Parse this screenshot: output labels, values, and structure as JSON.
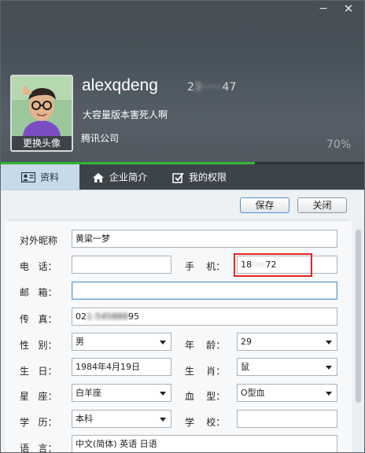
{
  "window": {
    "min_glyph": "−",
    "close_glyph": "✕"
  },
  "profile": {
    "avatar_caption": "更换头像",
    "nickname": "alexqdeng",
    "qq_prefix": "2",
    "qq_hidden": "3······",
    "qq_suffix": "47",
    "signature": "大容量版本害死人啊",
    "company": "腾讯公司",
    "completion_text": "70%",
    "completion": 0.7
  },
  "tabs": [
    {
      "label": "资料",
      "icon": "profile-card-icon",
      "active": true
    },
    {
      "label": "企业简介",
      "icon": "home-icon",
      "active": false
    },
    {
      "label": "我的权限",
      "icon": "checkbox-icon",
      "active": false
    }
  ],
  "toolbar": {
    "save_label": "保存",
    "close_label": "关闭"
  },
  "form": {
    "nickname_label": "对外昵称",
    "nickname_value": "黄粱一梦",
    "phone_label": "电   话：",
    "phone_value": "",
    "mobile_label": "手    机：",
    "mobile_prefix": "18",
    "mobile_hidden": "·····",
    "mobile_suffix": "72",
    "email_label": "邮   箱：",
    "email_value": "",
    "fax_label": "传   真：",
    "fax_prefix": "02",
    "fax_hidden": "1-545888",
    "fax_suffix": "95",
    "gender_label": "性   别：",
    "gender_value": "男",
    "age_label": "年    龄：",
    "age_value": "29",
    "birthday_label": "生   日：",
    "birthday_value": "1984年4月19日",
    "zodiac_label": "生    肖：",
    "zodiac_value": "鼠",
    "constellation_label": "星   座：",
    "constellation_value": "白羊座",
    "blood_label": "血    型：",
    "blood_value": "O型血",
    "education_label": "学   历：",
    "education_value": "本科",
    "school_label": "学    校：",
    "school_value": "",
    "language_label": "语   言：",
    "language_value": "中文(简体)  英语  日语"
  },
  "colors": {
    "header_bg": "#4a545c",
    "progress_fill": "#35b335",
    "active_tab_bg": "#c8d9e7",
    "highlight_box": "#e52323"
  }
}
